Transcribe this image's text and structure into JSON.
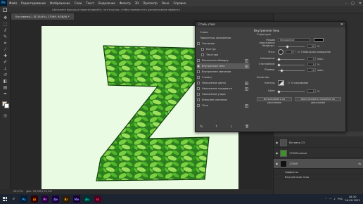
{
  "menubar": {
    "items": [
      "Файл",
      "Редактирование",
      "Изображение",
      "Слои",
      "Текст",
      "Выделение",
      "Фильтр",
      "3D",
      "Просмотр",
      "Окно",
      "Справка"
    ],
    "ps_label": "Ps"
  },
  "optbar": {
    "hint": "Щелкните мышью и перетаскивайте, не отпуская, чтобы переместить расположение эффекта"
  },
  "document": {
    "tab_title": "Без имени-1 @ 28,6% (17069, RGB/8) *",
    "zoom": "28,57%",
    "doc_info": "Док: 49,9M/1,51,2M"
  },
  "dialog": {
    "title": "Стиль слоя",
    "styles": [
      {
        "label": "Стили",
        "check": false,
        "plus": false
      },
      {
        "label": "Параметры наложения",
        "check": false,
        "plus": false
      },
      {
        "label": "Тиснение",
        "check": true,
        "on": false,
        "plus": false
      },
      {
        "label": "Контур",
        "check": true,
        "on": false,
        "plus": false
      },
      {
        "label": "Текстура",
        "check": true,
        "on": false,
        "plus": false
      },
      {
        "label": "Выполнить обводку",
        "check": true,
        "on": false,
        "plus": true
      },
      {
        "label": "Внутренняя тень",
        "check": true,
        "on": true,
        "plus": true,
        "selected": true
      },
      {
        "label": "Внутреннее свечение",
        "check": true,
        "on": false,
        "plus": false
      },
      {
        "label": "Глянец",
        "check": true,
        "on": false,
        "plus": false
      },
      {
        "label": "Наложение цвета",
        "check": true,
        "on": false,
        "plus": true
      },
      {
        "label": "Наложение градиента",
        "check": true,
        "on": false,
        "plus": true
      },
      {
        "label": "Наложение узора",
        "check": true,
        "on": false,
        "plus": false
      },
      {
        "label": "Внешнее свечение",
        "check": true,
        "on": false,
        "plus": false
      },
      {
        "label": "Тень",
        "check": true,
        "on": false,
        "plus": true
      }
    ],
    "bottom_icons": [
      "fx",
      "↑",
      "↓",
      "🗑"
    ],
    "settings": {
      "heading": "Внутренняя тень",
      "section": "Структура",
      "blend_label": "Режим наложения:",
      "blend_value": "Умножение",
      "shadow_color": "#000000",
      "opacity_label": "Непрозр.:",
      "opacity_value": "35",
      "angle_label": "Угол:",
      "angle_value": "0",
      "global_light": "Глобальное освещение",
      "offset_label": "Смещение:",
      "offset_value": "0",
      "choke_label": "Стягивание:",
      "choke_value": "0",
      "size_label": "Размер:",
      "size_value": "16",
      "unit_percent": "%",
      "unit_px": "пикс.",
      "quality": "Качество",
      "contour_label": "Контур:",
      "antialias": "Сглаживание",
      "noise_label": "Шум:",
      "noise_value": "0",
      "default_btn": "Использовать по умолчанию",
      "reset_btn": "Восстановить значения по умолчанию"
    }
  },
  "layers": [
    {
      "name": "Вставка 23",
      "thumb": "#4d4d4d",
      "type": "layer"
    },
    {
      "name": "17069 копия",
      "thumb": "#3f8f2a",
      "type": "layer"
    },
    {
      "name": "17069",
      "thumb": "#111111",
      "type": "layer",
      "selected": true,
      "fx": "fx"
    },
    {
      "name": "Эффекты",
      "type": "sub"
    },
    {
      "name": "Внутренняя тень",
      "type": "sub"
    }
  ],
  "taskbar": {
    "apps": [
      {
        "label": "Ps",
        "bg": "#001e36",
        "fg": "#31a8ff"
      },
      {
        "label": "Ai",
        "bg": "#330000",
        "fg": "#ff9a00"
      },
      {
        "label": "Pr",
        "bg": "#2a0040",
        "fg": "#d291ff"
      },
      {
        "label": "Ae",
        "bg": "#1a0040",
        "fg": "#9999ff"
      },
      {
        "label": "Br",
        "bg": "#2e1b00",
        "fg": "#e8a64c"
      },
      {
        "label": "Me",
        "bg": "#1a0032",
        "fg": "#8a8aff"
      },
      {
        "label": "Au",
        "bg": "#003030",
        "fg": "#00e4bb"
      },
      {
        "label": "Id",
        "bg": "#49021f",
        "fg": "#ff3366"
      }
    ],
    "lang": "РУС",
    "time": "16:30",
    "date": "26.09.2023"
  }
}
